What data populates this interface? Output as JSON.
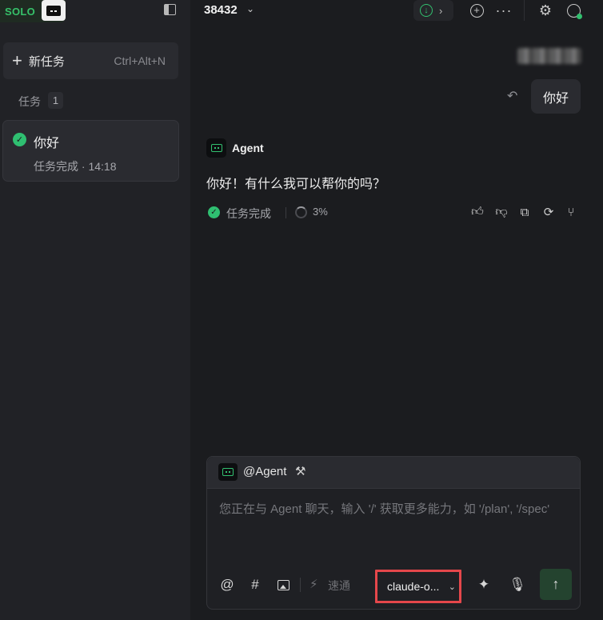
{
  "sidebar": {
    "brand": "SOLO",
    "new_task": {
      "label": "新任务",
      "shortcut": "Ctrl+Alt+N"
    },
    "tasks_section": {
      "label": "任务",
      "count": "1"
    },
    "tasks": [
      {
        "title": "你好",
        "status": "任务完成 · 14:18"
      }
    ]
  },
  "header": {
    "project": "38432"
  },
  "chat": {
    "user_message": "你好",
    "agent": {
      "name": "Agent",
      "message": "你好！有什么我可以帮你的吗？",
      "status": "任务完成",
      "progress": "3%"
    }
  },
  "composer": {
    "agent_label": "@Agent",
    "placeholder": "您正在与 Agent 聊天，输入 '/' 获取更多能力，如 '/plan', '/spec'",
    "speed_label": "速通",
    "model": "claude-o..."
  },
  "colors": {
    "accent_green": "#32c06f",
    "highlight_red": "#e5474b"
  }
}
